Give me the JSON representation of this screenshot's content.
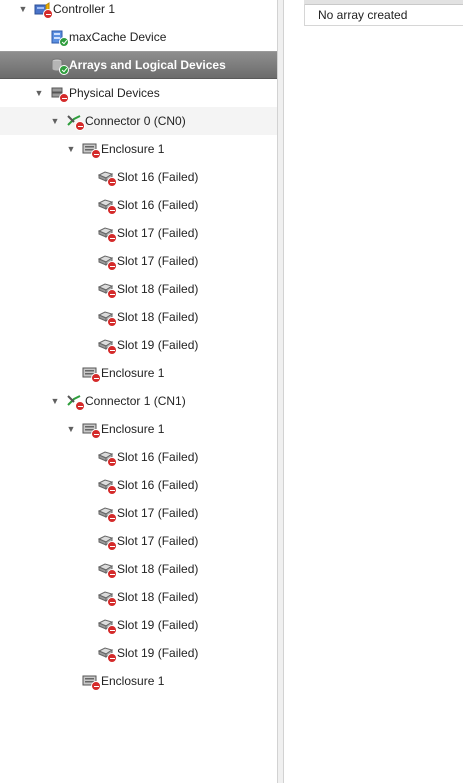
{
  "tree": {
    "rows": [
      {
        "label": "Controller 1",
        "name": "tree-item-controller-1",
        "indent": 0,
        "expander": "down",
        "icon": "controller-icon",
        "badge": "red"
      },
      {
        "label": "maxCache Device",
        "name": "tree-item-maxcache-device",
        "indent": 1,
        "expander": "none",
        "icon": "maxcache-icon",
        "badge": "green"
      },
      {
        "label": "Arrays and Logical Devices",
        "name": "tree-item-arrays-logical-devices",
        "indent": 1,
        "expander": "none",
        "icon": "arrays-icon",
        "badge": "green",
        "selected": true
      },
      {
        "label": "Physical Devices",
        "name": "tree-item-physical-devices",
        "indent": 1,
        "expander": "down",
        "icon": "physical-devices-icon",
        "badge": "red"
      },
      {
        "label": "Connector 0 (CN0)",
        "name": "tree-item-connector-0",
        "indent": 2,
        "expander": "down",
        "icon": "connector-icon",
        "badge": "red",
        "hover": true
      },
      {
        "label": "Enclosure 1",
        "name": "tree-item-enclosure-1",
        "indent": 3,
        "expander": "down",
        "icon": "enclosure-icon",
        "badge": "red"
      },
      {
        "label": "Slot 16 (Failed)",
        "name": "tree-item-slot",
        "indent": 4,
        "expander": "none",
        "icon": "drive-icon",
        "badge": "red"
      },
      {
        "label": "Slot 16 (Failed)",
        "name": "tree-item-slot",
        "indent": 4,
        "expander": "none",
        "icon": "drive-icon",
        "badge": "red"
      },
      {
        "label": "Slot 17 (Failed)",
        "name": "tree-item-slot",
        "indent": 4,
        "expander": "none",
        "icon": "drive-icon",
        "badge": "red"
      },
      {
        "label": "Slot 17 (Failed)",
        "name": "tree-item-slot",
        "indent": 4,
        "expander": "none",
        "icon": "drive-icon",
        "badge": "red"
      },
      {
        "label": "Slot 18 (Failed)",
        "name": "tree-item-slot",
        "indent": 4,
        "expander": "none",
        "icon": "drive-icon",
        "badge": "red"
      },
      {
        "label": "Slot 18 (Failed)",
        "name": "tree-item-slot",
        "indent": 4,
        "expander": "none",
        "icon": "drive-icon",
        "badge": "red"
      },
      {
        "label": "Slot 19 (Failed)",
        "name": "tree-item-slot",
        "indent": 4,
        "expander": "none",
        "icon": "drive-icon",
        "badge": "red"
      },
      {
        "label": "Enclosure 1",
        "name": "tree-item-enclosure-1",
        "indent": 3,
        "expander": "none",
        "icon": "enclosure-icon",
        "badge": "red"
      },
      {
        "label": "Connector 1 (CN1)",
        "name": "tree-item-connector-1",
        "indent": 2,
        "expander": "down",
        "icon": "connector-icon",
        "badge": "red"
      },
      {
        "label": "Enclosure 1",
        "name": "tree-item-enclosure-1",
        "indent": 3,
        "expander": "down",
        "icon": "enclosure-icon",
        "badge": "red"
      },
      {
        "label": "Slot 16 (Failed)",
        "name": "tree-item-slot",
        "indent": 4,
        "expander": "none",
        "icon": "drive-icon",
        "badge": "red"
      },
      {
        "label": "Slot 16 (Failed)",
        "name": "tree-item-slot",
        "indent": 4,
        "expander": "none",
        "icon": "drive-icon",
        "badge": "red"
      },
      {
        "label": "Slot 17 (Failed)",
        "name": "tree-item-slot",
        "indent": 4,
        "expander": "none",
        "icon": "drive-icon",
        "badge": "red"
      },
      {
        "label": "Slot 17 (Failed)",
        "name": "tree-item-slot",
        "indent": 4,
        "expander": "none",
        "icon": "drive-icon",
        "badge": "red"
      },
      {
        "label": "Slot 18 (Failed)",
        "name": "tree-item-slot",
        "indent": 4,
        "expander": "none",
        "icon": "drive-icon",
        "badge": "red"
      },
      {
        "label": "Slot 18 (Failed)",
        "name": "tree-item-slot",
        "indent": 4,
        "expander": "none",
        "icon": "drive-icon",
        "badge": "red"
      },
      {
        "label": "Slot 19 (Failed)",
        "name": "tree-item-slot",
        "indent": 4,
        "expander": "none",
        "icon": "drive-icon",
        "badge": "red"
      },
      {
        "label": "Slot 19 (Failed)",
        "name": "tree-item-slot",
        "indent": 4,
        "expander": "none",
        "icon": "drive-icon",
        "badge": "red"
      },
      {
        "label": "Enclosure 1",
        "name": "tree-item-enclosure-1",
        "indent": 3,
        "expander": "none",
        "icon": "enclosure-icon",
        "badge": "red"
      }
    ]
  },
  "detail": {
    "empty_message": "No array created"
  },
  "colors": {
    "selected_bg": "#7a7a7a",
    "status_failed": "#d42a2a",
    "status_ok": "#2e9d3c"
  }
}
